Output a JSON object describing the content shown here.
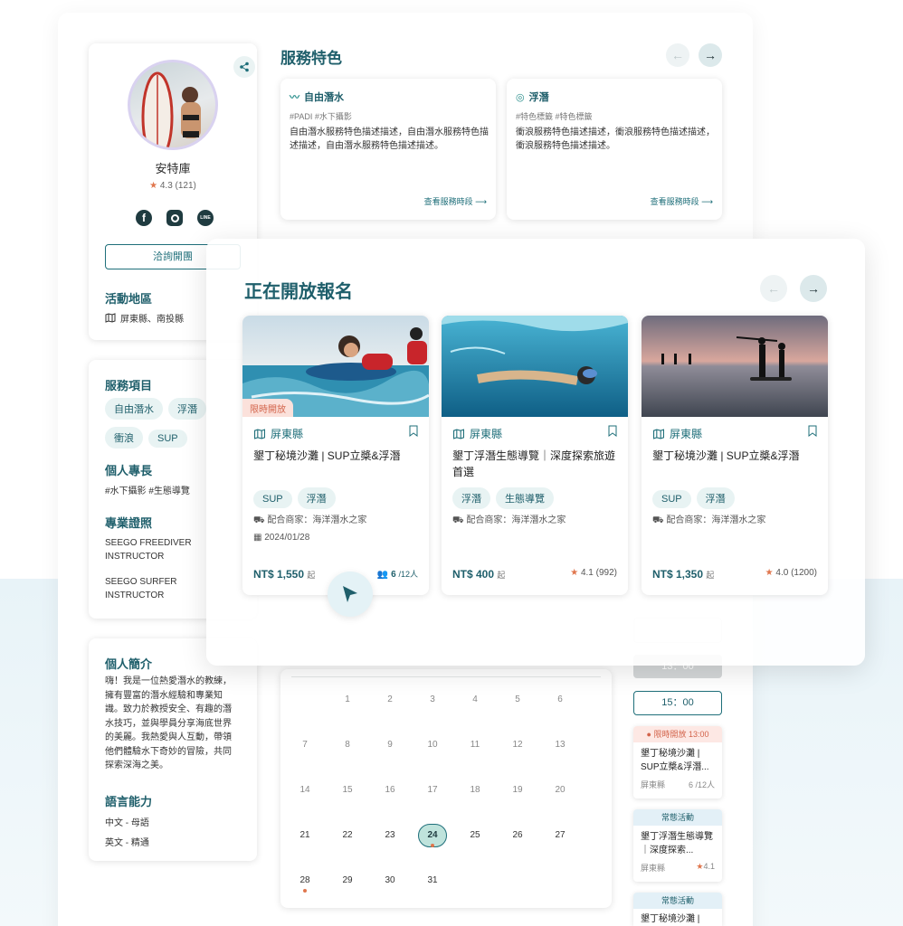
{
  "profile": {
    "name": "安特庫",
    "rating": "4.3 (121)",
    "social": [
      "facebook-icon",
      "instagram-icon",
      "line-icon"
    ],
    "line_label": "LINE",
    "contact_button": "洽詢開團",
    "region_title": "活動地區",
    "region_value": "屏東縣、南投縣"
  },
  "services": {
    "title": "服務項目",
    "items": [
      "自由潛水",
      "浮潛",
      "衝浪",
      "SUP"
    ],
    "specialty_title": "個人專長",
    "specialty_value": "#水下攝影  #生態導覽",
    "cert_title": "專業證照",
    "certs": [
      "SEEGO FREEDIVER INSTRUCTOR",
      "SEEGO SURFER INSTRUCTOR"
    ]
  },
  "bio": {
    "title": "個人簡介",
    "text": "嗨！我是一位熱愛潛水的教練，擁有豐富的潛水經驗和專業知識。致力於教授安全、有趣的潛水技巧，並與學員分享海底世界的美麗。我熱愛與人互動，帶領他們體驗水下奇妙的冒險，共同探索深海之美。",
    "lang_title": "語言能力",
    "langs": [
      "中文 - 母語",
      "英文 - 精通"
    ]
  },
  "features": {
    "title": "服務特色",
    "cards": [
      {
        "title": "自由潛水",
        "tags": "#PADI  #水下攝影",
        "desc": "自由潛水服務特色描述描述，自由潛水服務特色描述描述，自由潛水服務特色描述描述。",
        "more": "查看服務時段"
      },
      {
        "title": "浮潛",
        "tags": "#特色標籤  #特色標籤",
        "desc": "衝浪服務特色描述描述，衝浪服務特色描述描述，衝浪服務特色描述描述。",
        "more": "查看服務時段"
      }
    ]
  },
  "open": {
    "title": "正在開放報名",
    "tours": [
      {
        "badge": "限時開放",
        "loc": "屏東縣",
        "name": "墾丁秘境沙灘 | SUP立槳&浮潛",
        "chips": [
          "SUP",
          "浮潛"
        ],
        "partner": "配合商家：海洋潛水之家",
        "date": "2024/01/28",
        "price": "NT$ 1,550",
        "price_unit": "起",
        "people": "6",
        "people_total": "/12人"
      },
      {
        "loc": "屏東縣",
        "name": "墾丁浮潛生態導覽｜深度探索旅遊首選",
        "chips": [
          "浮潛",
          "生態導覽"
        ],
        "partner": "配合商家：海洋潛水之家",
        "price": "NT$ 400",
        "price_unit": "起",
        "rating": "4.1 (992)"
      },
      {
        "loc": "屏東縣",
        "name": "墾丁秘境沙灘 | SUP立槳&浮潛",
        "chips": [
          "SUP",
          "浮潛"
        ],
        "partner": "配合商家：海洋潛水之家",
        "price": "NT$ 1,350",
        "price_unit": "起",
        "rating": "4.0 (1200)"
      }
    ]
  },
  "calendar": {
    "rows": [
      [
        "",
        "1",
        "2",
        "3",
        "4",
        "5",
        "6"
      ],
      [
        "7",
        "8",
        "9",
        "10",
        "11",
        "12",
        "13"
      ],
      [
        "14",
        "15",
        "16",
        "17",
        "18",
        "19",
        "20"
      ],
      [
        "21",
        "22",
        "23",
        "24",
        "25",
        "26",
        "27"
      ],
      [
        "28",
        "29",
        "30",
        "31",
        "",
        "",
        ""
      ]
    ],
    "selected": "24"
  },
  "slots": {
    "times": [
      "13：00",
      "15：00"
    ],
    "cards": [
      {
        "header": "● 限時開放 13:00",
        "name": "墾丁秘境沙灘 | SUP立槳&浮潛...",
        "loc": "屏東縣",
        "right": "6 /12人"
      },
      {
        "header": "常態活動",
        "name": "墾丁浮潛生態導覽｜深度探索...",
        "loc": "屏東縣",
        "right": "4.1"
      },
      {
        "header": "常態活動",
        "name": "墾丁秘境沙灘 |"
      }
    ]
  }
}
